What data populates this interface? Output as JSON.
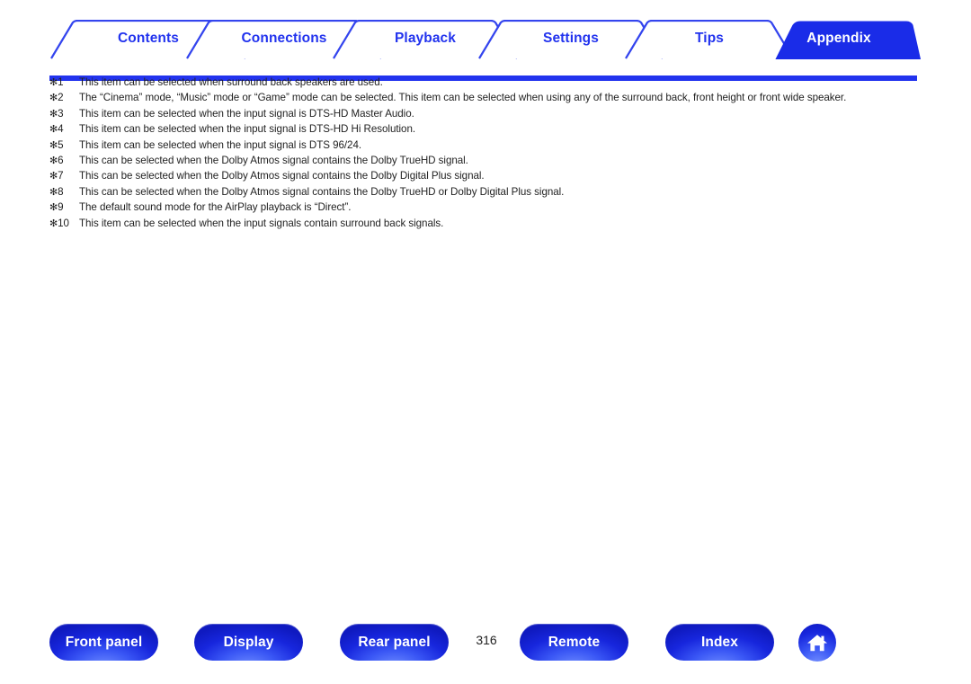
{
  "tabs": [
    {
      "label": "Contents",
      "active": false
    },
    {
      "label": "Connections",
      "active": false
    },
    {
      "label": "Playback",
      "active": false
    },
    {
      "label": "Settings",
      "active": false
    },
    {
      "label": "Tips",
      "active": false
    },
    {
      "label": "Appendix",
      "active": true
    }
  ],
  "footnotes": [
    {
      "marker": "1",
      "text": "This item can be selected when surround back speakers are used."
    },
    {
      "marker": "2",
      "text": "The “Cinema” mode, “Music” mode or “Game” mode can be selected. This item can be selected when using any of the surround back, front height or front wide speaker."
    },
    {
      "marker": "3",
      "text": "This item can be selected when the input signal is DTS-HD Master Audio."
    },
    {
      "marker": "4",
      "text": "This item can be selected when the input signal is DTS-HD Hi Resolution."
    },
    {
      "marker": "5",
      "text": "This item can be selected when the input signal is DTS 96/24."
    },
    {
      "marker": "6",
      "text": "This can be selected when the Dolby Atmos signal contains the Dolby TrueHD signal."
    },
    {
      "marker": "7",
      "text": "This can be selected when the Dolby Atmos signal contains the Dolby Digital Plus signal."
    },
    {
      "marker": "8",
      "text": "This can be selected when the Dolby Atmos signal contains the Dolby TrueHD or Dolby Digital Plus signal."
    },
    {
      "marker": "9",
      "text": "The default sound mode for the AirPlay playback is “Direct”."
    },
    {
      "marker": "10",
      "text": "This item can be selected when the input signals contain surround back signals."
    }
  ],
  "footnote_marker_symbol": "✻",
  "bottom_nav": {
    "buttons": [
      {
        "label": "Front panel"
      },
      {
        "label": "Display"
      },
      {
        "label": "Rear panel"
      },
      {
        "label": "Remote"
      },
      {
        "label": "Index"
      }
    ],
    "page_number": "316",
    "home_icon": "home-icon"
  },
  "colors": {
    "brand_blue": "#2233ee",
    "tab_active_fill": "#1a2ce8",
    "button_blue": "#2233ee",
    "text": "#222222",
    "page_background": "#ffffff"
  }
}
